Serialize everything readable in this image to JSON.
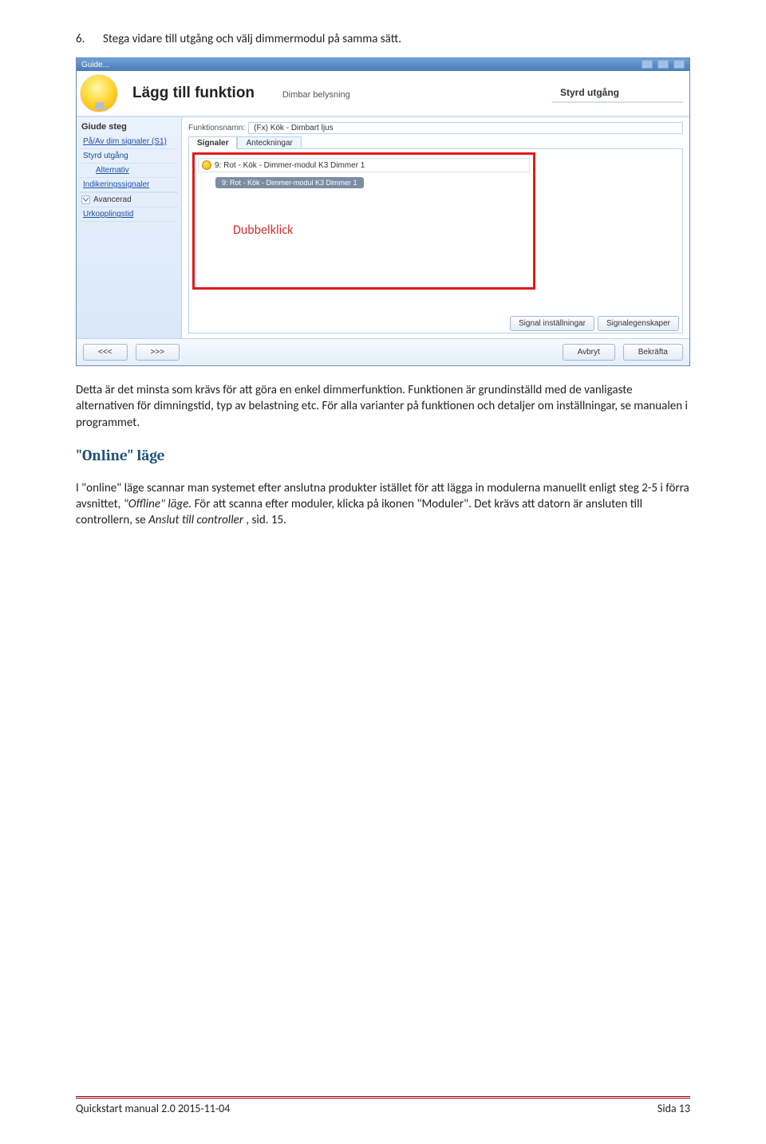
{
  "instruction": {
    "num": "6.",
    "text": "Stega vidare till utgång och välj dimmermodul på samma sätt."
  },
  "annotation": {
    "dubbelklick": "Dubbelklick"
  },
  "screenshot": {
    "windowTitle": "Guide...",
    "headerTitle": "Lägg till funktion",
    "headerSubtitle": "Dimbar belysning",
    "styrdUtgang": "Styrd utgång",
    "sidebar": {
      "heading": "Giude steg",
      "items": [
        {
          "label": "På/Av dim signaler (S1)"
        },
        {
          "label": "Styrd utgång"
        },
        {
          "label": "Alternativ",
          "indent": true
        },
        {
          "label": "Indikeringssignaler"
        }
      ],
      "advanced": "Avancerad",
      "urkoppling": "Urkopplingstid"
    },
    "main": {
      "funcLabel": "Funktionsnamn:",
      "funcValue": "(Fx) Kök - Dimbart ljus",
      "tabs": {
        "signaler": "Signaler",
        "anteckningar": "Anteckningar"
      },
      "itemText": "9: Rot - Kök - Dimmer-modul K3 Dimmer 1",
      "tagText": "9: Rot - Kök - Dimmer-modul K3 Dimmer 1",
      "panelButtons": {
        "signalInst": "Signal inställningar",
        "signalEg": "Signalegenskaper"
      }
    },
    "footer": {
      "back": "<<<",
      "fwd": ">>>",
      "avbryt": "Avbryt",
      "bekrafta": "Bekräfta"
    }
  },
  "paragraphs": {
    "p1a": "Detta är det minsta som krävs för att göra en enkel dimmerfunktion. Funktionen är grundinställd med de vanligaste alternativen för dimningstid, typ av belastning etc. För alla varianter på funktionen och detaljer om inställningar, se manualen i programmet.",
    "onlineHeading": "\"Online\" läge",
    "p2_pre": "I \"online\" läge scannar man systemet efter anslutna produkter istället för att lägga in modulerna manuellt enligt steg 2-5 i förra avsnittet, ",
    "p2_ital1": "\"Offline\" läge.",
    "p2_mid": " För att scanna efter moduler, klicka på ikonen \"Moduler\". Det krävs att datorn är ansluten till controllern, se ",
    "p2_ital2": "Anslut till controller",
    "p2_end": ", sid. 15."
  },
  "pageFooter": {
    "left": "Quickstart manual 2.0 2015-11-04",
    "right": "Sida 13"
  }
}
